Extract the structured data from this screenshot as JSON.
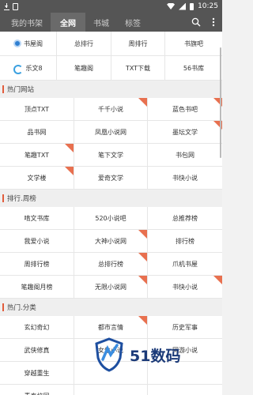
{
  "status": {
    "time": "10:25"
  },
  "header": {
    "tabs": [
      {
        "label": "我的书架"
      },
      {
        "label": "全网"
      },
      {
        "label": "书城"
      },
      {
        "label": "标签"
      }
    ],
    "active_tab_index": 1
  },
  "quick_sites": [
    {
      "label": "书屋阁",
      "icon": "blue-circle-logo-icon"
    },
    {
      "label": "总排行"
    },
    {
      "label": "周排行"
    },
    {
      "label": "书旗吧"
    },
    {
      "label": "乐文8",
      "icon": "c-logo-icon"
    },
    {
      "label": "笔趣阁"
    },
    {
      "label": "TXT下载"
    },
    {
      "label": "56书库"
    }
  ],
  "sections": [
    {
      "title": "热门网站",
      "items": [
        {
          "label": "顶点TXT",
          "corner": false
        },
        {
          "label": "千千小说",
          "corner": true
        },
        {
          "label": "蓝色书吧",
          "corner": true
        },
        {
          "label": "品书网",
          "corner": false
        },
        {
          "label": "凤凰小说网",
          "corner": false
        },
        {
          "label": "墨坛文学",
          "corner": true
        },
        {
          "label": "笔趣TXT",
          "corner": true
        },
        {
          "label": "笔下文学",
          "corner": false
        },
        {
          "label": "书包网",
          "corner": false
        },
        {
          "label": "文学楼",
          "corner": true
        },
        {
          "label": "爱奇文学",
          "corner": false
        },
        {
          "label": "书快小说",
          "corner": false
        }
      ]
    },
    {
      "title": "排行.周榜",
      "items": [
        {
          "label": "啃文书库",
          "corner": false
        },
        {
          "label": "520小说吧",
          "corner": false
        },
        {
          "label": "总推荐榜",
          "corner": false
        },
        {
          "label": "我爱小说",
          "corner": false
        },
        {
          "label": "大神小说网",
          "corner": true
        },
        {
          "label": "排行榜",
          "corner": false
        },
        {
          "label": "周排行榜",
          "corner": false
        },
        {
          "label": "总排行榜",
          "corner": true
        },
        {
          "label": "爪机书屋",
          "corner": false
        },
        {
          "label": "笔趣阁月榜",
          "corner": false
        },
        {
          "label": "无限小说网",
          "corner": true
        },
        {
          "label": "书快小说",
          "corner": true
        }
      ]
    },
    {
      "title": "热门.分类",
      "items": [
        {
          "label": "玄幻奇幻",
          "corner": false
        },
        {
          "label": "都市言情",
          "corner": true
        },
        {
          "label": "历史军事",
          "corner": false
        },
        {
          "label": "武侠修真",
          "corner": false
        },
        {
          "label": "女生小说",
          "corner": false
        },
        {
          "label": "网游小说",
          "corner": false
        },
        {
          "label": "穿越重生",
          "corner": false
        },
        {
          "label": "",
          "corner": false
        },
        {
          "label": "",
          "corner": false
        },
        {
          "label": "青春校园",
          "corner": false
        },
        {
          "label": "",
          "corner": false
        },
        {
          "label": "",
          "corner": false
        }
      ]
    }
  ],
  "watermark": {
    "text": "51数码"
  },
  "colors": {
    "accent": "#e25c3c",
    "header_bg": "#555555",
    "corner": "#e8704f"
  }
}
